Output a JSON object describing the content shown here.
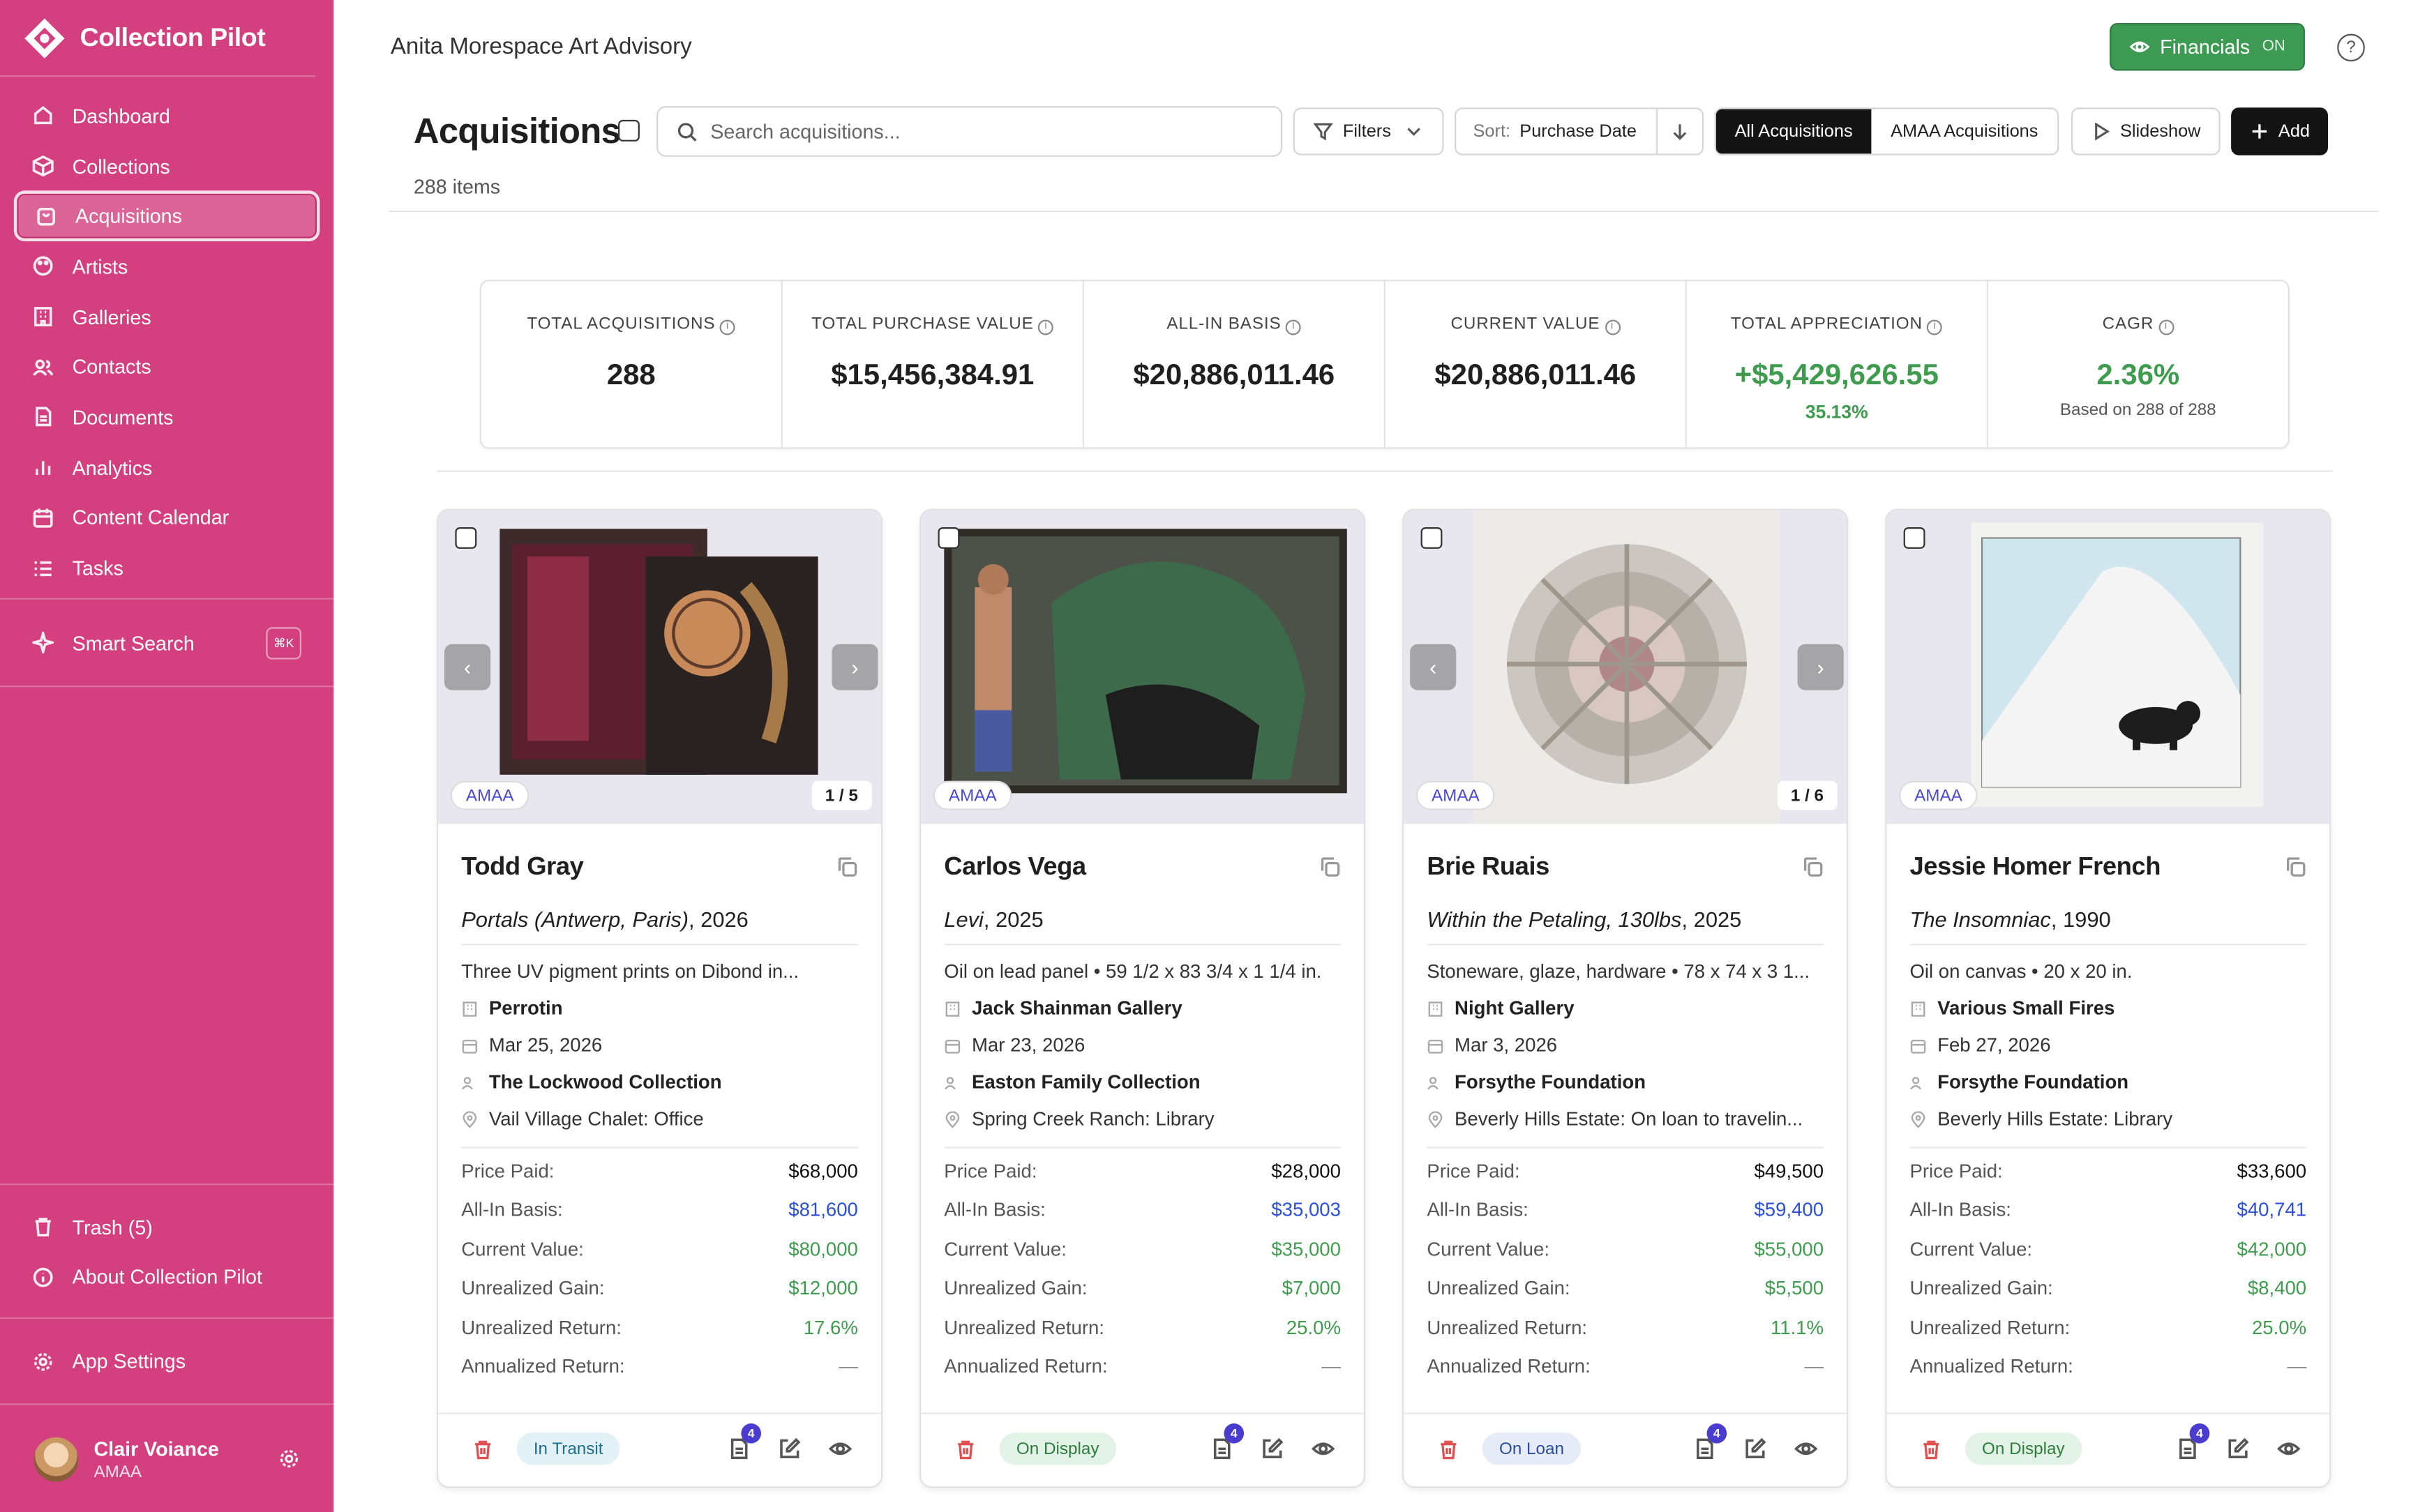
{
  "app": {
    "name": "Collection Pilot"
  },
  "sidebar": {
    "items": [
      {
        "label": "Dashboard",
        "icon": "home-icon"
      },
      {
        "label": "Collections",
        "icon": "box-icon"
      },
      {
        "label": "Acquisitions",
        "icon": "bag-icon",
        "active": true
      },
      {
        "label": "Artists",
        "icon": "palette-icon"
      },
      {
        "label": "Galleries",
        "icon": "building-icon"
      },
      {
        "label": "Contacts",
        "icon": "users-icon"
      },
      {
        "label": "Documents",
        "icon": "file-icon"
      },
      {
        "label": "Analytics",
        "icon": "bar-chart-icon"
      },
      {
        "label": "Content Calendar",
        "icon": "calendar-icon"
      },
      {
        "label": "Tasks",
        "icon": "list-icon"
      }
    ],
    "smart_search": {
      "label": "Smart Search",
      "shortcut": "⌘K"
    },
    "trash": "Trash (5)",
    "about": "About Collection Pilot",
    "settings": "App Settings",
    "user": {
      "name": "Clair Voiance",
      "org": "AMAA"
    }
  },
  "header": {
    "org": "Anita Morespace Art Advisory",
    "financials": "Financials",
    "financials_state": "ON",
    "help": "?"
  },
  "toolbar": {
    "title": "Acquisitions",
    "count": "288 items",
    "search_placeholder": "Search acquisitions...",
    "filters": "Filters",
    "sort_label": "Sort:",
    "sort_value": "Purchase Date",
    "seg_all": "All Acquisitions",
    "seg_amaa": "AMAA Acquisitions",
    "slideshow": "Slideshow",
    "add": "Add"
  },
  "stats": [
    {
      "label": "TOTAL ACQUISITIONS",
      "value": "288",
      "sub": ""
    },
    {
      "label": "TOTAL PURCHASE VALUE",
      "value": "$15,456,384.91",
      "sub": ""
    },
    {
      "label": "ALL-IN BASIS",
      "value": "$20,886,011.46",
      "sub": ""
    },
    {
      "label": "CURRENT VALUE",
      "value": "$20,886,011.46",
      "sub": ""
    },
    {
      "label": "TOTAL APPRECIATION",
      "value": "+$5,429,626.55",
      "sub": "35.13%"
    },
    {
      "label": "CAGR",
      "value": "2.36%",
      "sub": "Based on 288 of 288"
    }
  ],
  "fin_labels": {
    "price": "Price Paid:",
    "basis": "All-In Basis:",
    "current": "Current Value:",
    "gain": "Unrealized Gain:",
    "ret": "Unrealized Return:",
    "ann": "Annualized Return:"
  },
  "cards": [
    {
      "badge": "AMAA",
      "counter": "1 / 5",
      "artist": "Todd Gray",
      "title": "Portals (Antwerp, Paris)",
      "year": ", 2026",
      "medium": "Three UV pigment prints on Dibond in...",
      "gallery": "Perrotin",
      "date": "Mar 25, 2026",
      "collection": "The Lockwood Collection",
      "location": "Vail Village Chalet: Office",
      "price": "$68,000",
      "basis": "$81,600",
      "current": "$80,000",
      "gain": "$12,000",
      "ret": "17.6%",
      "ann": "—",
      "status": "In Transit",
      "docs": "4"
    },
    {
      "badge": "AMAA",
      "counter": "",
      "artist": "Carlos Vega",
      "title": "Levi",
      "year": ", 2025",
      "medium": "Oil on lead panel • 59 1/2 x 83 3/4 x 1 1/4 in.",
      "gallery": "Jack Shainman Gallery",
      "date": "Mar 23, 2026",
      "collection": "Easton Family Collection",
      "location": "Spring Creek Ranch: Library",
      "price": "$28,000",
      "basis": "$35,003",
      "current": "$35,000",
      "gain": "$7,000",
      "ret": "25.0%",
      "ann": "—",
      "status": "On Display",
      "docs": "4"
    },
    {
      "badge": "AMAA",
      "counter": "1 / 6",
      "artist": "Brie Ruais",
      "title": "Within the Petaling, 130lbs",
      "year": ", 2025",
      "medium": "Stoneware, glaze, hardware • 78 x 74 x 3 1...",
      "gallery": "Night Gallery",
      "date": "Mar 3, 2026",
      "collection": "Forsythe Foundation",
      "location": "Beverly Hills Estate: On loan to travelin...",
      "price": "$49,500",
      "basis": "$59,400",
      "current": "$55,000",
      "gain": "$5,500",
      "ret": "11.1%",
      "ann": "—",
      "status": "On Loan",
      "docs": "4"
    },
    {
      "badge": "AMAA",
      "counter": "",
      "artist": "Jessie Homer French",
      "title": "The Insomniac",
      "year": ", 1990",
      "medium": "Oil on canvas • 20 x 20 in.",
      "gallery": "Various Small Fires",
      "date": "Feb 27, 2026",
      "collection": "Forsythe Foundation",
      "location": "Beverly Hills Estate: Library",
      "price": "$33,600",
      "basis": "$40,741",
      "current": "$42,000",
      "gain": "$8,400",
      "ret": "25.0%",
      "ann": "—",
      "status": "On Display",
      "docs": "4"
    }
  ]
}
